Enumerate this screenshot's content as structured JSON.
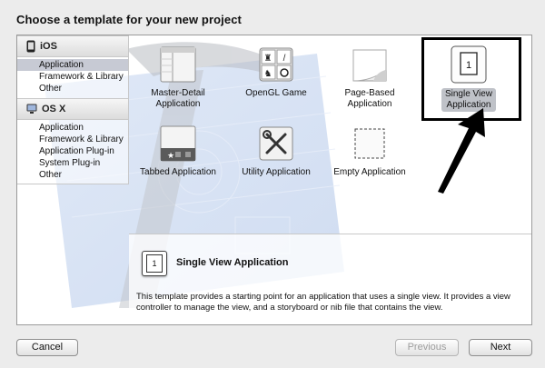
{
  "window": {
    "title": "Choose a template for your new project"
  },
  "sidebar": {
    "sections": [
      {
        "label": "iOS",
        "items": [
          "Application",
          "Framework & Library",
          "Other"
        ],
        "selected_index": 0
      },
      {
        "label": "OS X",
        "items": [
          "Application",
          "Framework & Library",
          "Application Plug-in",
          "System Plug-in",
          "Other"
        ],
        "selected_index": -1
      }
    ]
  },
  "templates": {
    "row1": [
      {
        "label": "Master-Detail\nApplication",
        "icon": "master-detail-icon"
      },
      {
        "label": "OpenGL Game",
        "icon": "opengl-game-icon"
      },
      {
        "label": "Page-Based\nApplication",
        "icon": "page-based-icon"
      },
      {
        "label": "Single View\nApplication",
        "icon": "single-view-icon",
        "selected": true
      }
    ],
    "row2": [
      {
        "label": "Tabbed Application",
        "icon": "tabbed-icon"
      },
      {
        "label": "Utility Application",
        "icon": "utility-icon"
      },
      {
        "label": "Empty Application",
        "icon": "empty-icon"
      }
    ],
    "single_view_glyph": "1"
  },
  "description": {
    "title": "Single View Application",
    "text": "This template provides a starting point for an application that uses a single view. It provides a view controller to manage the view, and a storyboard or nib file that contains the view.",
    "icon_glyph": "1"
  },
  "buttons": {
    "cancel": "Cancel",
    "previous": "Previous",
    "next": "Next"
  },
  "colors": {
    "selection_highlight": "#c7cad4",
    "annotation": "#000000"
  }
}
